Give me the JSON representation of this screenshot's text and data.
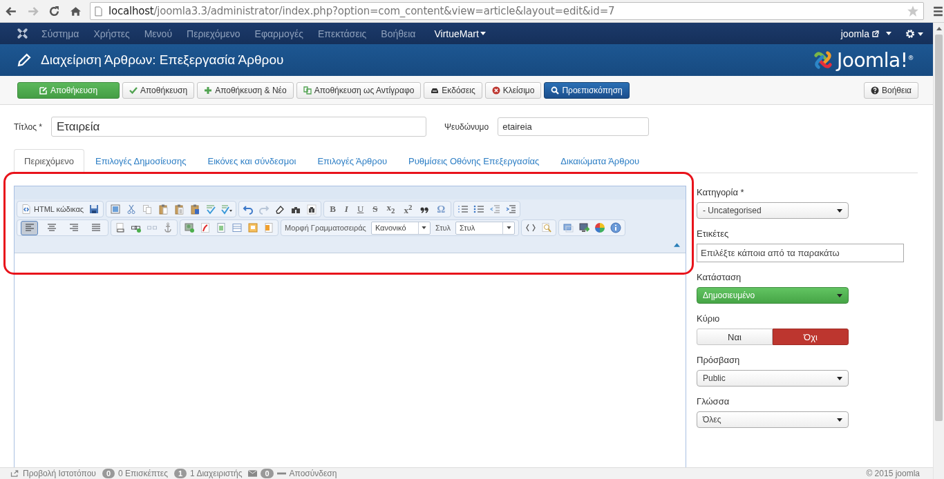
{
  "browser": {
    "url_host": "localhost",
    "url_path": "/joomla3.3/administrator/index.php?option=com_content&view=article&layout=edit&id=7"
  },
  "nav": {
    "items": [
      {
        "label": "Σύστημα"
      },
      {
        "label": "Χρήστες"
      },
      {
        "label": "Μενού"
      },
      {
        "label": "Περιεχόμενο"
      },
      {
        "label": "Εφαρμογές"
      },
      {
        "label": "Επεκτάσεις"
      },
      {
        "label": "Βοήθεια"
      }
    ],
    "extension_menu": "VirtueMart",
    "user": "joomla"
  },
  "header": {
    "title": "Διαχείριση Άρθρων: Επεξεργασία Άρθρου",
    "brand": "Joomla!$^{®}$"
  },
  "toolbar": {
    "buttons": [
      {
        "label": "Αποθήκευση",
        "kind": "save"
      },
      {
        "label": "Αποθήκευση",
        "kind": "apply"
      },
      {
        "label": "Αποθήκευση & Νέο",
        "kind": "new"
      },
      {
        "label": "Αποθήκευση ως Αντίγραφο",
        "kind": "copy"
      },
      {
        "label": "Εκδόσεις",
        "kind": "versions"
      },
      {
        "label": "Κλείσιμο",
        "kind": "close"
      },
      {
        "label": "Προεπισκόπηση",
        "kind": "preview"
      }
    ],
    "help": "Βοήθεια"
  },
  "form": {
    "title_label": "Τίτλος *",
    "title_value": "Εταιρεία",
    "alias_label": "Ψευδώνυμο",
    "alias_value": "etaireia"
  },
  "tabs": [
    {
      "label": "Περιεχόμενο",
      "selected": true
    },
    {
      "label": "Επιλογές Δημοσίευσης",
      "selected": false
    },
    {
      "label": "Εικόνες και σύνδεσμοι",
      "selected": false
    },
    {
      "label": "Επιλογές Άρθρου",
      "selected": false
    },
    {
      "label": "Ρυθμίσεις Οθόνης Επεξεργασίας",
      "selected": false
    },
    {
      "label": "Δικαιώματα Άρθρου",
      "selected": false
    }
  ],
  "editor": {
    "source_button": "HTML κώδικας",
    "format_glyphs": [
      "B",
      "I",
      "U",
      "S",
      "x$_{2}$",
      "x$^{2}$"
    ],
    "symbol_glyph": "Ω",
    "alignment": [
      {
        "selected": true
      },
      {
        "selected": false
      },
      {
        "selected": false
      },
      {
        "selected": false
      }
    ],
    "font_format_label": "Μορφή Γραμματοσειράς",
    "font_format_value": "Κανονικό",
    "style_label": "Στυλ",
    "style_value": "Στυλ"
  },
  "sidebar": {
    "fields": [
      {
        "kind": "select",
        "label": "Κατηγορία *",
        "value": "- Uncategorised"
      },
      {
        "kind": "text",
        "label": "Ετικέτες",
        "placeholder": "Επιλέξτε κάποια από τα παρακάτω"
      },
      {
        "kind": "status",
        "label": "Κατάσταση",
        "value": "Δημοσιευμένο"
      },
      {
        "kind": "toggle",
        "label": "Κύριο",
        "options": [
          {
            "label": "Ναι",
            "selected": false
          },
          {
            "label": "Όχι",
            "selected": true
          }
        ]
      },
      {
        "kind": "select",
        "label": "Πρόσβαση",
        "value": "Public"
      },
      {
        "kind": "select",
        "label": "Γλώσσα",
        "value": "Όλες"
      }
    ]
  },
  "status_bar": {
    "view_site": "Προβολή Ιστοτόπου",
    "visitors_count": "0",
    "visitors": "0 Επισκέπτες",
    "admins_count": "1",
    "admins": "1 Διαχειριστής",
    "messages_count": "0",
    "logout": "Αποσύνδεση",
    "copyright": "© 2015 joomla"
  }
}
